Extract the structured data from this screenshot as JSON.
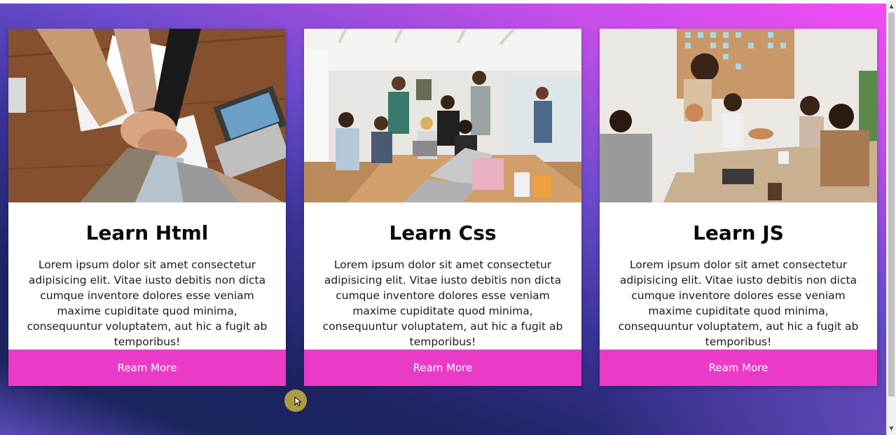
{
  "cards": [
    {
      "title": "Learn Html",
      "text": "Lorem ipsum dolor sit amet consectetur adipisicing elit. Vitae iusto debitis non dicta cumque inventore dolores esse veniam maxime cupiditate quod minima, consequuntur voluptatem, aut hic a fugit ab temporibus!",
      "button": "Ream More"
    },
    {
      "title": "Learn Css",
      "text": "Lorem ipsum dolor sit amet consectetur adipisicing elit. Vitae iusto debitis non dicta cumque inventore dolores esse veniam maxime cupiditate quod minima, consequuntur voluptatem, aut hic a fugit ab temporibus!",
      "button": "Ream More"
    },
    {
      "title": "Learn JS",
      "text": "Lorem ipsum dolor sit amet consectetur adipisicing elit. Vitae iusto debitis non dicta cumque inventore dolores esse veniam maxime cupiditate quod minima, consequuntur voluptatem, aut hic a fugit ab temporibus!",
      "button": "Ream More"
    }
  ],
  "colors": {
    "button": "#ea3ac8",
    "gradient_top": "#f64cf5",
    "gradient_bottom": "#1b255e"
  },
  "icons": {
    "scroll_up": "chevron-up-icon",
    "scroll_down": "chevron-down-icon",
    "cursor": "mouse-pointer-icon"
  }
}
